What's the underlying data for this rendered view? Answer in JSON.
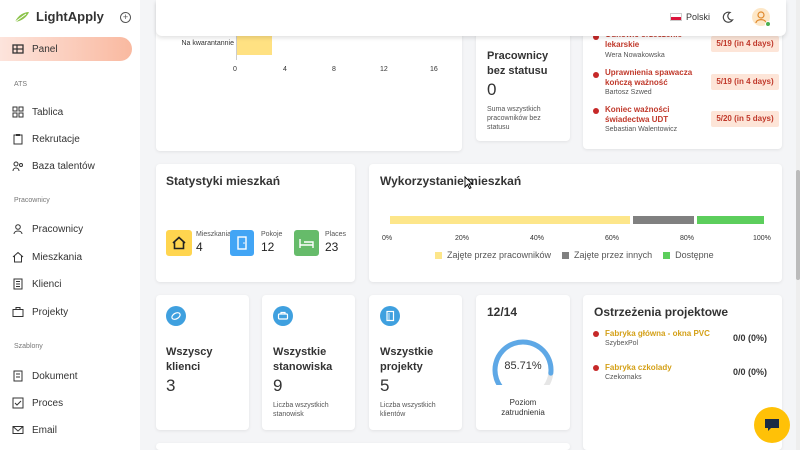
{
  "app": {
    "name": "LightApply"
  },
  "nav": {
    "panel": "Panel",
    "ats_label": "ATS",
    "ats_items": [
      "Tablica",
      "Rekrutacje",
      "Baza talentów"
    ],
    "employees_label": "Pracownicy",
    "employees_items": [
      "Pracownicy",
      "Mieszkania",
      "Klienci",
      "Projekty"
    ],
    "templates_label": "Szablony",
    "templates_items": [
      "Dokument",
      "Proces",
      "Email"
    ]
  },
  "header": {
    "language": "Polski"
  },
  "quarantine_chart": {
    "label": "Na kwarantannie",
    "ticks": [
      "0",
      "4",
      "8",
      "12",
      "16"
    ]
  },
  "no_status": {
    "title": "Pracownicy bez statusu",
    "value": "0",
    "description": "Suma wszystkich pracowników bez statusu"
  },
  "expirations": [
    {
      "title": "Odnowić orzeczenie lekarskie",
      "person": "Wera Nowakowska",
      "badge": "5/19 (in 4 days)"
    },
    {
      "title": "Uprawnienia spawacza kończą ważność",
      "person": "Bartosz Szwed",
      "badge": "5/19 (in 4 days)"
    },
    {
      "title": "Koniec ważności świadectwa UDT",
      "person": "Sebastian Walentowicz",
      "badge": "5/20 (in 5 days)"
    }
  ],
  "housing_stats": {
    "title": "Statystyki mieszkań",
    "items": [
      {
        "label": "Mieszkania",
        "value": "4",
        "color": "#ffd54f"
      },
      {
        "label": "Pokoje",
        "value": "12",
        "color": "#42a5f5"
      },
      {
        "label": "Places",
        "value": "23",
        "color": "#66bb6a"
      }
    ]
  },
  "housing_usage": {
    "title": "Wykorzystanie mieszkań",
    "ticks": [
      "0%",
      "20%",
      "40%",
      "60%",
      "80%",
      "100%"
    ],
    "segments": [
      {
        "name": "Zajęte przez pracowników",
        "color": "#fde68a",
        "fraction": 0.65
      },
      {
        "name": "Zajęte przez innych",
        "color": "#808080",
        "fraction": 0.17
      },
      {
        "name": "Dostępne",
        "color": "#5cce5c",
        "fraction": 0.18
      }
    ]
  },
  "stats": [
    {
      "title": "Wszyscy klienci",
      "value": "3",
      "description": ""
    },
    {
      "title": "Wszystkie stanowiska",
      "value": "9",
      "description": "Liczba wszystkich stanowisk"
    },
    {
      "title": "Wszystkie projekty",
      "value": "5",
      "description": "Liczba wszystkich klientów"
    }
  ],
  "employment": {
    "ratio": "12/14",
    "percent": "85.71%",
    "fraction": 0.8571,
    "label": "Poziom zatrudnienia"
  },
  "project_warnings": {
    "title": "Ostrzeżenia projektowe",
    "items": [
      {
        "title": "Fabryka główna - okna PVC",
        "company": "SzybexPol",
        "value": "0/0 (0%)"
      },
      {
        "title": "Fabryka czkolady",
        "company": "Czekomaks",
        "value": "0/0 (0%)"
      }
    ]
  }
}
